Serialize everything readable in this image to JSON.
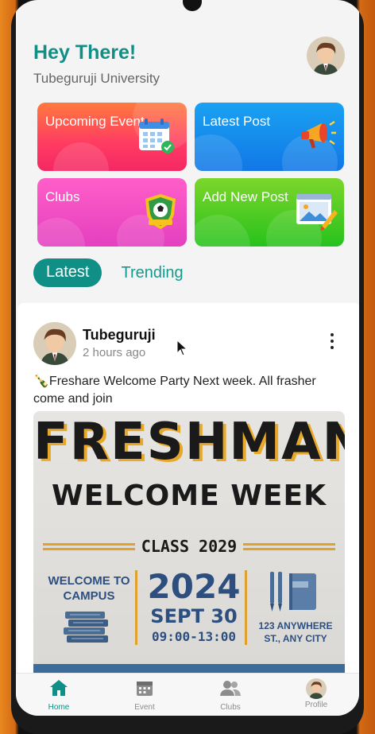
{
  "header": {
    "greeting": "Hey There!",
    "university": "Tubeguruji University"
  },
  "cards": [
    {
      "label": "Upcoming Event",
      "icon": "calendar-check-icon"
    },
    {
      "label": "Latest Post",
      "icon": "megaphone-icon"
    },
    {
      "label": "Clubs",
      "icon": "soccer-badge-icon"
    },
    {
      "label": "Add New Post",
      "icon": "image-edit-icon"
    }
  ],
  "tabs": {
    "active": "Latest",
    "other": "Trending"
  },
  "post": {
    "user": "Tubeguruji",
    "time": "2 hours ago",
    "text": "🍾Freshare Welcome Party Next week. All frasher come and join",
    "poster": {
      "title": "FRESHMAN",
      "subtitle": "WELCOME WEEK",
      "class": "CLASS 2029",
      "welcome": "WELCOME TO CAMPUS",
      "year": "2024",
      "date": "SEPT 30",
      "time": "09:00-13:00",
      "address": "123 ANYWHERE ST., ANY CITY"
    }
  },
  "nav": [
    {
      "label": "Home",
      "icon": "home-icon",
      "active": true
    },
    {
      "label": "Event",
      "icon": "calendar-icon",
      "active": false
    },
    {
      "label": "Clubs",
      "icon": "people-icon",
      "active": false
    },
    {
      "label": "Profile",
      "icon": "avatar-icon",
      "active": false
    }
  ],
  "colors": {
    "accent": "#0f8f86",
    "poster_blue": "#2d4f80",
    "poster_gold": "#e0a22c"
  }
}
